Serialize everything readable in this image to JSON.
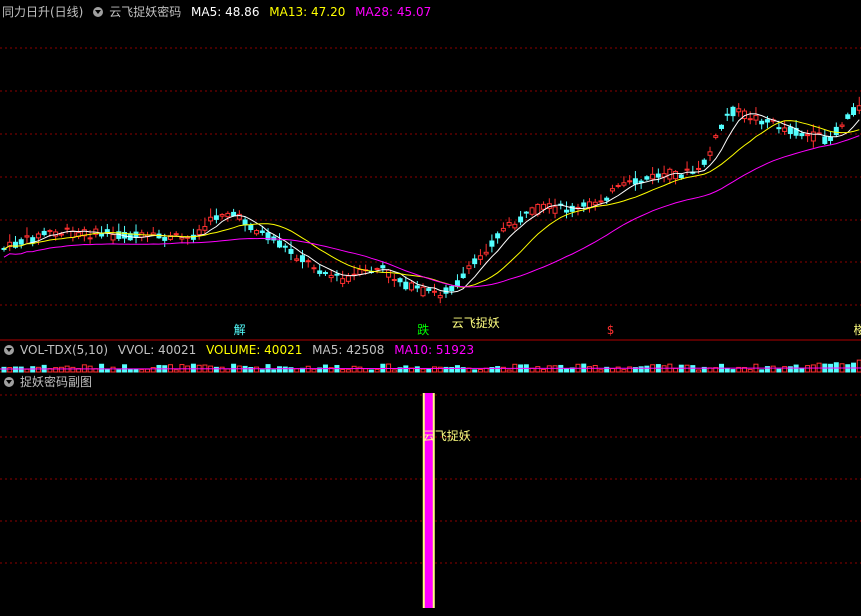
{
  "main_header": {
    "title": "同力日升(日线)",
    "indicator": "云飞捉妖密码",
    "ma5": "MA5: 48.86",
    "ma13": "MA13: 47.20",
    "ma28": "MA28: 45.07"
  },
  "vol_header": {
    "title": "VOL-TDX(5,10)",
    "vvol": "VVOL: 40021",
    "volume": "VOLUME: 40021",
    "ma5": "MA5: 42508",
    "ma10": "MA10: 51923"
  },
  "sub_header": {
    "title": "捉妖密码副图"
  },
  "colors": {
    "up": "#ff3030",
    "down": "#54ffff",
    "ma5": "#ffffff",
    "ma13": "#ffff00",
    "ma28": "#ff00ff",
    "grid": "#8b0000",
    "divider": "#b00000",
    "signal_yellow": "#ffff80",
    "magenta": "#ff00ff"
  },
  "chart_data": {
    "type": "candlestick",
    "count": 150,
    "markers": [
      {
        "label": "解",
        "bar": 40,
        "color": "#54ffff"
      },
      {
        "label": "跌",
        "bar": 72,
        "color": "#00ff00"
      },
      {
        "label": "云飞捉妖",
        "bar": 78,
        "color": "#ffff80"
      },
      {
        "label": "$",
        "bar": 105,
        "color": "#ff3030"
      },
      {
        "label": "楼",
        "bar": 148,
        "color": "#ffff80"
      }
    ],
    "sub_signal": {
      "label": "云飞捉妖",
      "bar": 74
    }
  }
}
